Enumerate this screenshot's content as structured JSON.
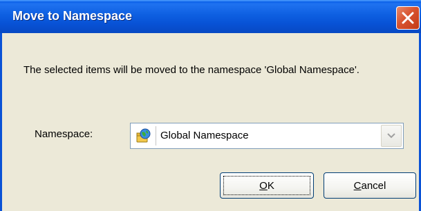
{
  "dialog": {
    "title": "Move to Namespace",
    "message": "The selected items will be moved to the namespace 'Global Namespace'.",
    "namespace_label": "Namespace:",
    "namespace_value": "Global Namespace",
    "ok_label_underlined": "O",
    "ok_label_rest": "K",
    "cancel_label_underlined": "C",
    "cancel_label_rest": "ancel"
  },
  "icons": {
    "close": "close-icon",
    "namespace": "namespace-globe-folder-icon",
    "dropdown": "chevron-down-icon"
  },
  "colors": {
    "titlebar": "#0a52d6",
    "close_button": "#d8532f",
    "dialog_bg": "#ece9d8"
  }
}
